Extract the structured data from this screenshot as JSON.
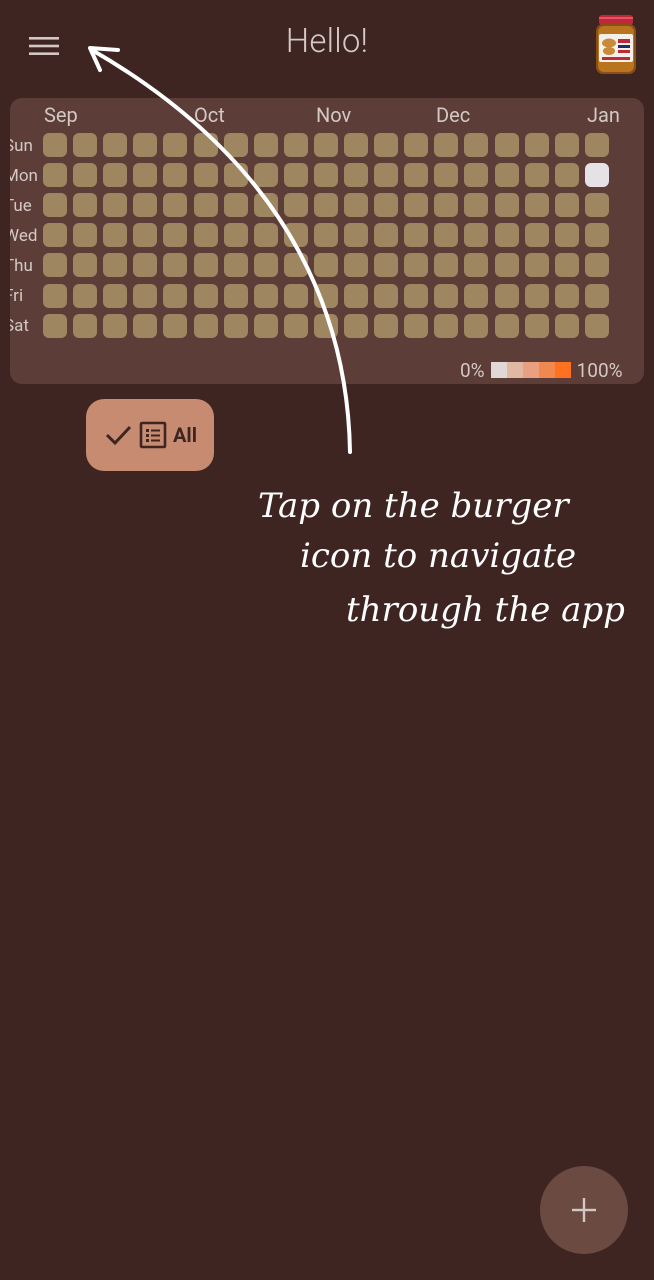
{
  "app": {
    "title": "Hello!"
  },
  "heatmap": {
    "months": [
      "Sep",
      "Oct",
      "Nov",
      "Dec",
      "Jan"
    ],
    "days": [
      "Sun",
      "Mon",
      "Tue",
      "Wed",
      "Thu",
      "Fri",
      "Sat"
    ],
    "weeks": 19,
    "today": {
      "week": 18,
      "day": "Mon"
    },
    "cell_color": "#9e8661",
    "today_color": "#e6e1e6",
    "legend": {
      "min_label": "0%",
      "max_label": "100%",
      "colors": [
        "#e0d8d4",
        "#e0b8a4",
        "#e8a080",
        "#f08850",
        "#ff7020"
      ]
    }
  },
  "filter": {
    "icons": [
      "check-icon",
      "list-icon"
    ],
    "label": "All"
  },
  "annotation": {
    "line1": "Tap on the burger",
    "line2": "icon to navigate",
    "line3": "through the app"
  },
  "fab": {
    "icon": "plus-icon"
  },
  "colors": {
    "background": "#3e2522",
    "card": "#5c3d37",
    "chip": "#c78b72",
    "fab": "#6b4a42",
    "text": "#d4c8c5"
  }
}
